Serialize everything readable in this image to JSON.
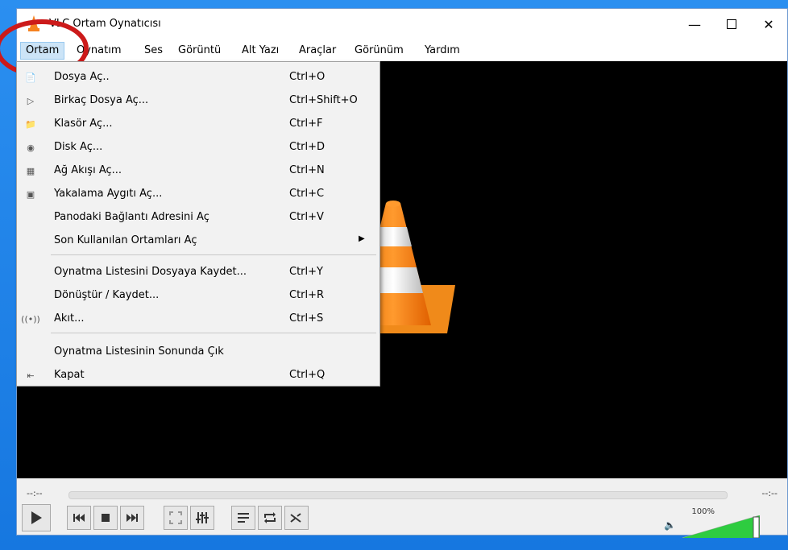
{
  "window": {
    "title": "VLC Ortam Oynatıcısı"
  },
  "menubar": [
    {
      "label": "Ortam"
    },
    {
      "label": "Oynatım"
    },
    {
      "label": "Ses"
    },
    {
      "label": "Görüntü"
    },
    {
      "label": "Alt Yazı"
    },
    {
      "label": "Araçlar"
    },
    {
      "label": "Görünüm"
    },
    {
      "label": "Yardım"
    }
  ],
  "media_menu": [
    {
      "label": "Dosya Aç..",
      "shortcut": "Ctrl+O",
      "icon": "file-icon"
    },
    {
      "label": "Birkaç Dosya Aç...",
      "shortcut": "Ctrl+Shift+O",
      "icon": "multiple-files-icon"
    },
    {
      "label": "Klasör Aç...",
      "shortcut": "Ctrl+F",
      "icon": "folder-icon"
    },
    {
      "label": "Disk Aç...",
      "shortcut": "Ctrl+D",
      "icon": "disc-icon"
    },
    {
      "label": "Ağ Akışı Aç...",
      "shortcut": "Ctrl+N",
      "icon": "network-icon"
    },
    {
      "label": "Yakalama Aygıtı Aç...",
      "shortcut": "Ctrl+C",
      "icon": "capture-device-icon"
    },
    {
      "label": "Panodaki Bağlantı Adresini Aç",
      "shortcut": "Ctrl+V",
      "icon": ""
    },
    {
      "label": "Son Kullanılan Ortamları Aç",
      "shortcut": "",
      "icon": "",
      "submenu": true
    },
    {
      "label": "Oynatma Listesini Dosyaya Kaydet...",
      "shortcut": "Ctrl+Y",
      "icon": ""
    },
    {
      "label": "Dönüştür / Kaydet...",
      "shortcut": "Ctrl+R",
      "icon": ""
    },
    {
      "label": "Akıt...",
      "shortcut": "Ctrl+S",
      "icon": "stream-icon"
    },
    {
      "label": "Oynatma Listesinin Sonunda Çık",
      "shortcut": "",
      "icon": ""
    },
    {
      "label": "Kapat",
      "shortcut": "Ctrl+Q",
      "icon": "exit-icon"
    }
  ],
  "controls": {
    "elapsed": "--:--",
    "remaining": "--:--",
    "volume_label": "100%",
    "volume_level": 1.0
  },
  "colors": {
    "accent": "#cc1a1a",
    "volume": "#2ecc40",
    "cone": "#f58220"
  }
}
